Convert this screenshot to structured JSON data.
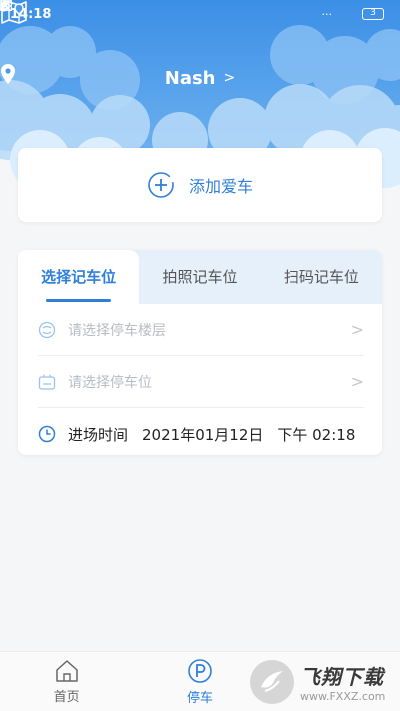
{
  "status_bar": {
    "time": "14:18",
    "battery": "3"
  },
  "header": {
    "location": "Nash",
    "map_icon": "map-pin-icon"
  },
  "add_car": {
    "label": "添加爱车"
  },
  "parking": {
    "tabs": [
      {
        "label": "选择记车位",
        "active": true
      },
      {
        "label": "拍照记车位",
        "active": false
      },
      {
        "label": "扫码记车位",
        "active": false
      }
    ],
    "floor_placeholder": "请选择停车楼层",
    "spot_placeholder": "请选择停车位",
    "entry_label": "进场时间",
    "entry_date": "2021年01月12日",
    "entry_time": "下午 02:18"
  },
  "tabbar": {
    "items": [
      {
        "label": "首页",
        "icon": "home-icon",
        "active": false
      },
      {
        "label": "停车",
        "icon": "parking-icon",
        "active": true
      }
    ]
  },
  "watermark": {
    "text": "飞翔下载",
    "url": "www.FXXZ.com"
  },
  "colors": {
    "accent": "#2f7fd8",
    "sky": "#3f95e8"
  }
}
